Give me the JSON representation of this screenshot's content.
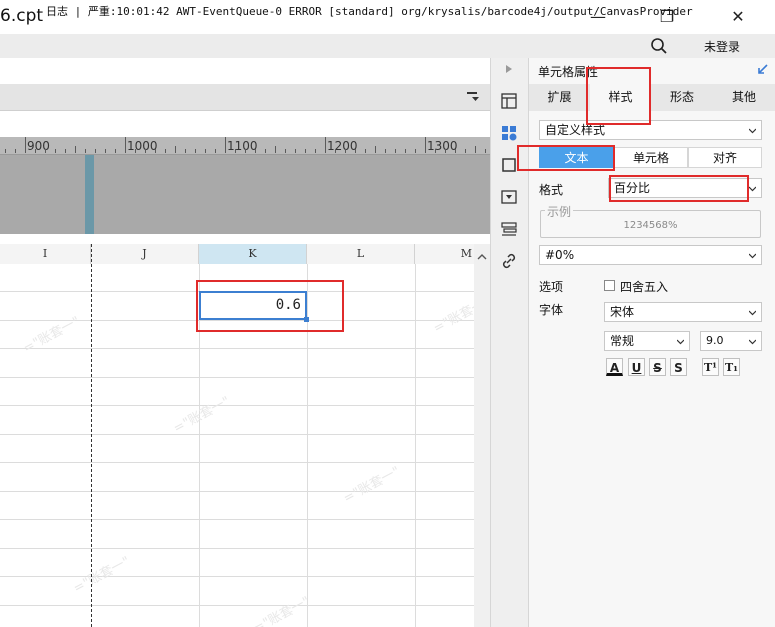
{
  "window": {
    "title": "6.cpt",
    "minimize_glyph": "—",
    "restore_glyph": "❐",
    "close_glyph": "✕"
  },
  "log_bar": {
    "text": "日志 | 严重:10:01:42 AWT-EventQueue-0 ERROR [standard] org/krysalis/barcode4j/output/CanvasProvider",
    "login_label": "未登录"
  },
  "ruler": {
    "labels": [
      "900",
      "1000",
      "1100",
      "1200",
      "1300"
    ]
  },
  "grid": {
    "columns": [
      "I",
      "J",
      "K",
      "L",
      "M"
    ],
    "selected_column": "K",
    "selected_cell_value": "0.6",
    "watermark": "=\"账套一\""
  },
  "panel": {
    "title": "单元格属性",
    "tabs": [
      "扩展",
      "样式",
      "形态",
      "其他"
    ],
    "active_tab": "样式",
    "style_preset": "自定义样式",
    "sub_tabs": [
      "文本",
      "单元格",
      "对齐"
    ],
    "active_sub_tab": "文本",
    "format_label": "格式",
    "format_value": "百分比",
    "example_legend": "示例",
    "example_value": "1234568%",
    "pattern_value": "#0%",
    "options_label": "选项",
    "rounding_label": "四舍五入",
    "rounding_checked": false,
    "font_label": "字体",
    "font_family": "宋体",
    "font_style": "常规",
    "font_size": "9.0",
    "format_buttons": [
      "A",
      "U",
      "S",
      "S",
      "T¹",
      "T₁"
    ]
  },
  "colors": {
    "accent_blue": "#4aa0ea",
    "selection_border": "#3c7fd1",
    "highlight_red": "#e02b2b",
    "canvas_marker": "#6b98a8"
  }
}
